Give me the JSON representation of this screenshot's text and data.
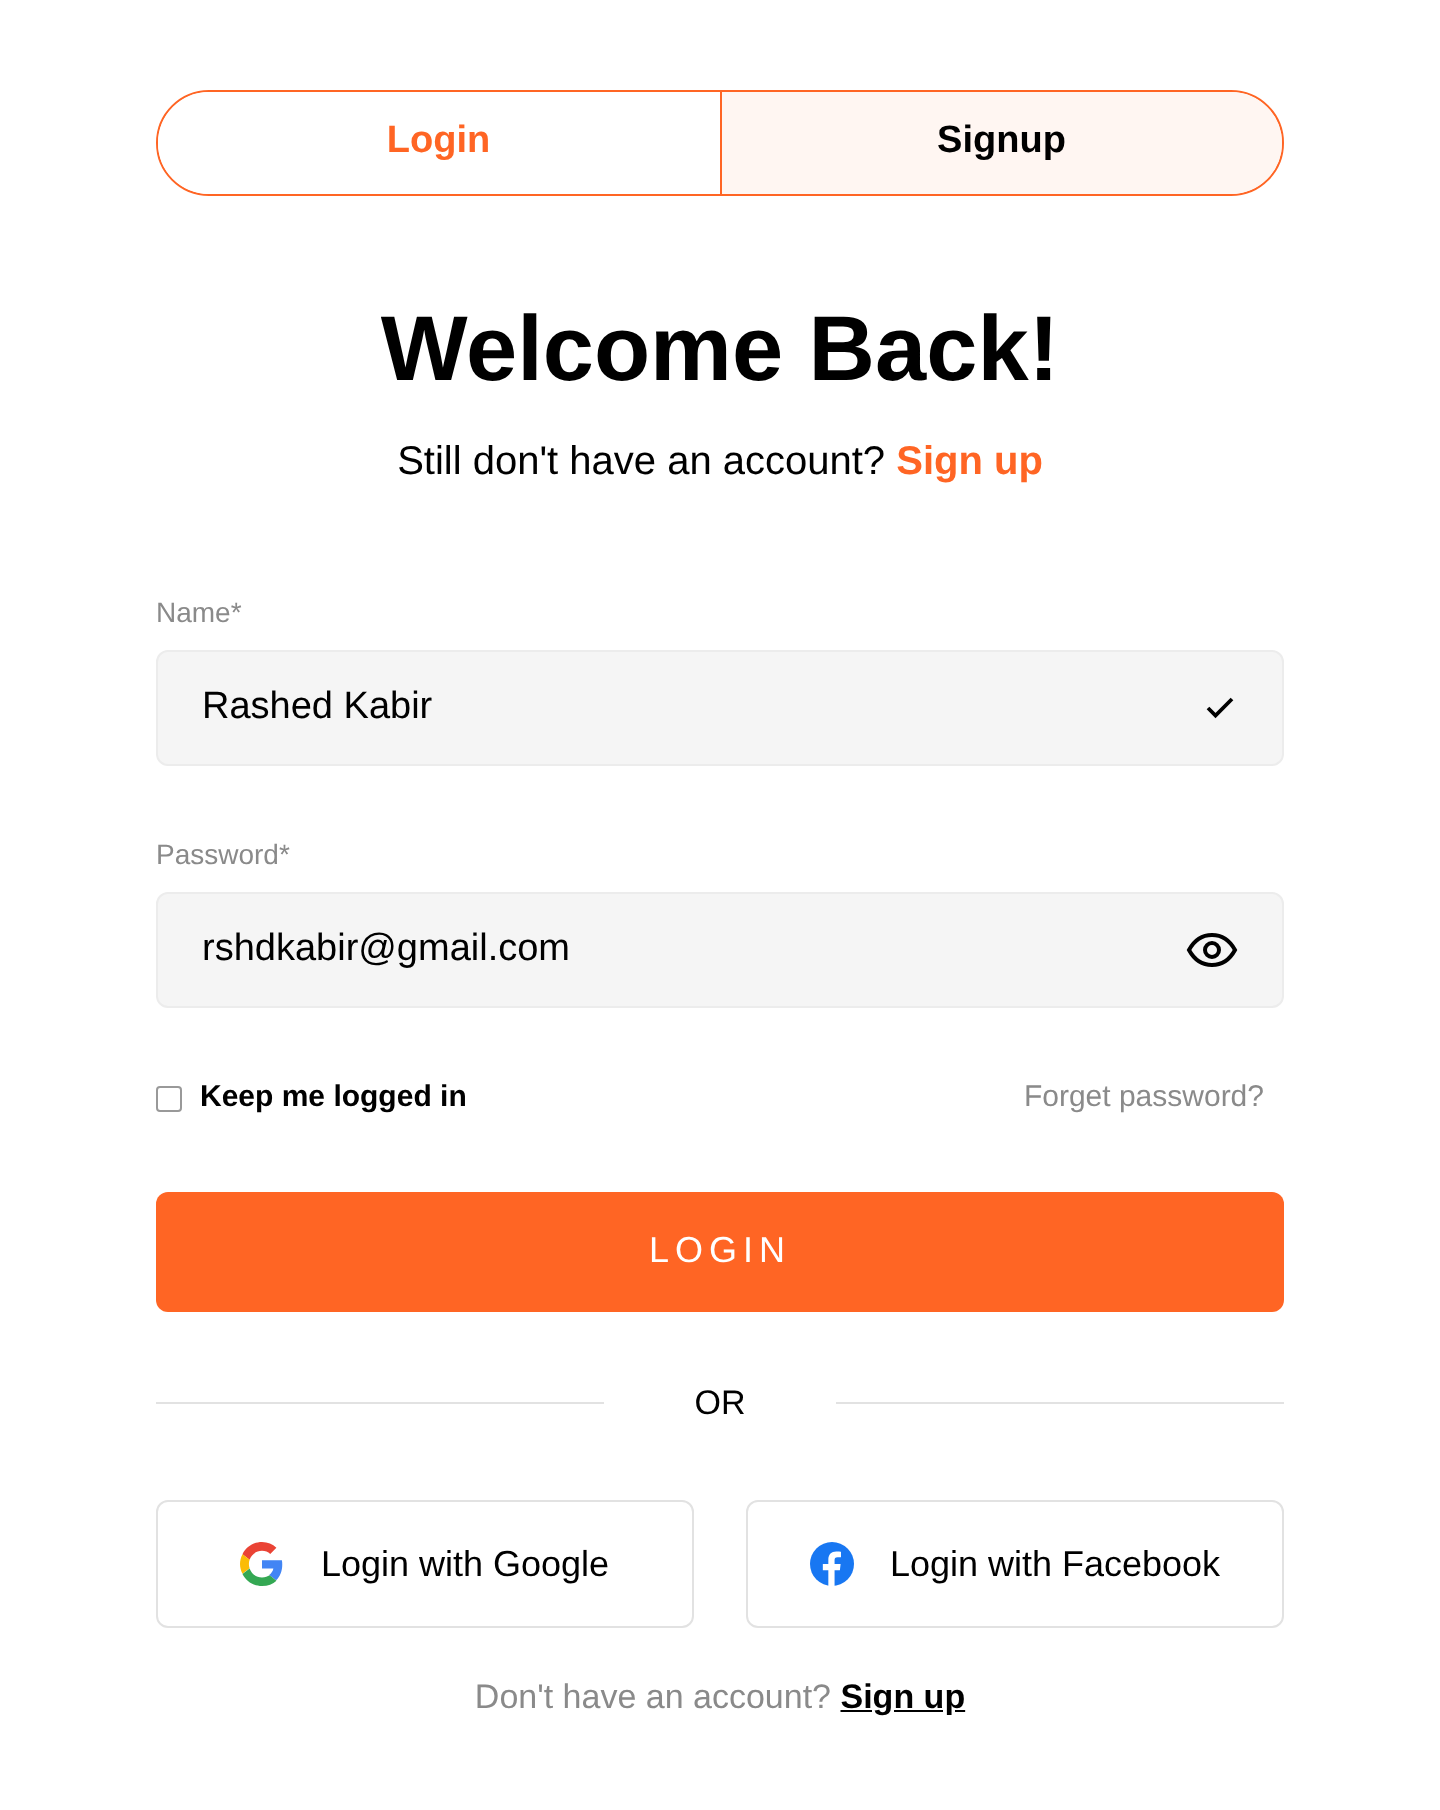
{
  "tabs": [
    {
      "label": "Login",
      "selected": true
    },
    {
      "label": "Signup",
      "selected": false
    }
  ],
  "heading": "Welcome Back!",
  "subtitle": {
    "text": "Still don't have an account?",
    "link": "Sign up"
  },
  "fields": [
    {
      "label": "Name*",
      "value": "Rashed Kabir",
      "kind": "validated"
    },
    {
      "label": "Password*",
      "value": "rshdkabir@gmail.com",
      "kind": "password"
    }
  ],
  "remember": {
    "label": "Keep me logged in",
    "checked": false
  },
  "forgot_link": "Forget password?",
  "submit": "LOGIN",
  "divider": "OR",
  "social": [
    {
      "label": "Login with Google",
      "kind": "google"
    },
    {
      "label": "Login with Facebook",
      "kind": "facebook"
    }
  ],
  "footer": {
    "text": "Don't have an account?",
    "link": "Sign up"
  }
}
